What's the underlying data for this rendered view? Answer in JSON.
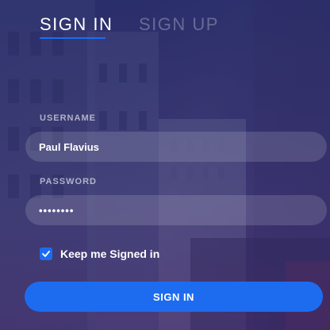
{
  "tabs": {
    "signin_label": "SIGN IN",
    "signup_label": "SIGN UP",
    "active": "signin"
  },
  "form": {
    "username_label": "USERNAME",
    "username_value": "Paul Flavius",
    "password_label": "PASSWORD",
    "password_value": "••••••••",
    "remember_label": "Keep me Signed in",
    "remember_checked": true,
    "submit_label": "SIGN IN"
  },
  "colors": {
    "accent": "#1d6cf0",
    "overlay": "#2e3274"
  },
  "icons": {
    "checkbox_check": "check-icon"
  }
}
